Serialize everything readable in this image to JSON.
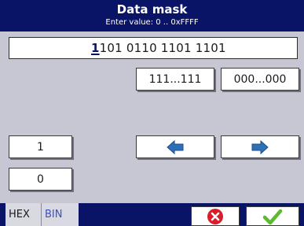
{
  "header": {
    "title": "Data mask",
    "subtitle": "Enter value: 0 .. 0xFFFF"
  },
  "value": {
    "cursor_char": "1",
    "rest": "101 0110 1101 1101"
  },
  "buttons": {
    "all_ones": "111...111",
    "all_zeros": "000...000",
    "digit_one": "1",
    "digit_zero": "0"
  },
  "tabs": {
    "hex": "HEX",
    "bin": "BIN"
  },
  "colors": {
    "header_bg": "#0a1466",
    "body_bg": "#c7c7d4",
    "arrow_blue": "#2f6fb5",
    "cancel_red": "#d81e2a",
    "ok_green": "#5fb832"
  },
  "icons": {
    "left": "arrow-left-icon",
    "right": "arrow-right-icon",
    "cancel": "cancel-icon",
    "ok": "checkmark-icon"
  }
}
